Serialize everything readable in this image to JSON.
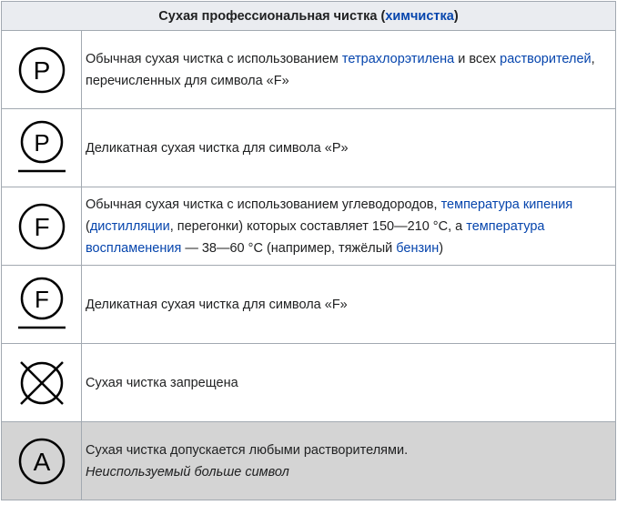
{
  "header": {
    "title_prefix": "Сухая профессиональная чистка (",
    "title_link": "химчистка",
    "title_suffix": ")"
  },
  "rows": [
    {
      "symbol_letter": "P",
      "parts": [
        {
          "t": "Обычная сухая чистка с использованием "
        },
        {
          "t": "тетрахлорэтилена",
          "link": true
        },
        {
          "t": " и всех "
        },
        {
          "t": "растворителей",
          "link": true
        },
        {
          "t": ", перечисленных для символа «F»"
        }
      ]
    },
    {
      "symbol_letter": "P",
      "parts": [
        {
          "t": "Деликатная сухая чистка для символа «P»"
        }
      ]
    },
    {
      "symbol_letter": "F",
      "parts": [
        {
          "t": "Обычная сухая чистка с использованием углеводородов, "
        },
        {
          "t": "температура кипения",
          "link": true
        },
        {
          "t": " ("
        },
        {
          "t": "дистилляции",
          "link": true
        },
        {
          "t": ", перегонки) которых составляет 150—210 °C, а "
        },
        {
          "t": "температура воспламенения",
          "link": true
        },
        {
          "t": " — 38—60 °C (например, тяжёлый "
        },
        {
          "t": "бензин",
          "link": true
        },
        {
          "t": ")"
        }
      ]
    },
    {
      "symbol_letter": "F",
      "parts": [
        {
          "t": "Деликатная сухая чистка для символа «F»"
        }
      ]
    },
    {
      "symbol_letter": "",
      "parts": [
        {
          "t": "Сухая чистка запрещена"
        }
      ]
    },
    {
      "symbol_letter": "A",
      "parts": [
        {
          "t": "Сухая чистка допускается любыми растворителями."
        },
        {
          "br": true
        },
        {
          "t": "Неиспользуемый больше символ",
          "italic": true
        }
      ]
    }
  ]
}
